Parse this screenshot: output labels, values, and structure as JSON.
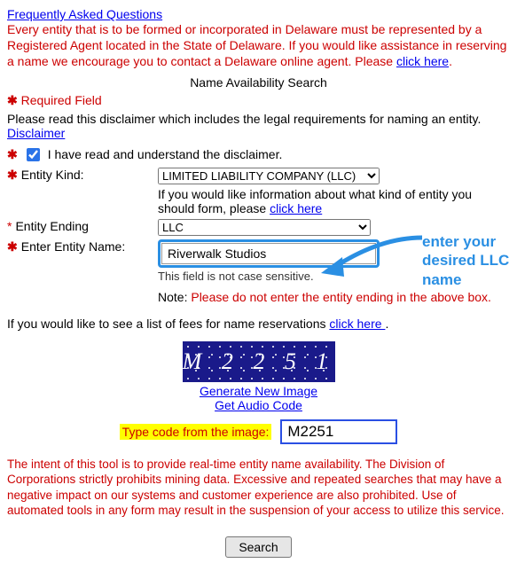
{
  "faq_link": "Frequently Asked Questions",
  "intro_text": "Every entity that is to be formed or incorporated in Delaware must be represented by a Registered Agent located in the State of Delaware. If you would like assistance in reserving a name we encourage you to contact a Delaware online agent. Please ",
  "click_here": "click here",
  "page_title": "Name Availability Search",
  "required_field_label": "Required Field",
  "disclaimer_intro": "Please read this disclaimer which includes the legal requirements for naming an entity.",
  "disclaimer_link": "Disclaimer",
  "consent_label": "I have read and understand the disclaimer.",
  "entity_kind_label": "Entity Kind:",
  "entity_kind_value": "LIMITED LIABILITY COMPANY (LLC)",
  "entity_kind_help": "If you would like information about what kind of entity you should form, please ",
  "entity_ending_label": "Entity Ending",
  "entity_ending_value": "LLC",
  "entity_name_label": "Enter Entity Name:",
  "entity_name_value": "Riverwalk Studios",
  "case_note": "This field is not case sensitive.",
  "no_ending_note_prefix": "Note: ",
  "no_ending_note": "Please do not enter the entity ending in the above box.",
  "fees_text": "If you would like to see a list of fees for name reservations ",
  "fees_link": "click here ",
  "captcha_text": "M 2 2 5 1",
  "gen_new_image": "Generate New Image",
  "get_audio": "Get Audio Code",
  "type_code_label": "Type code from the image:",
  "code_value": "M2251",
  "policy_text": "The intent of this tool is to provide real-time entity name availability. The Division of Corporations strictly prohibits mining data. Excessive and repeated searches that may have a negative impact on our systems and customer experience are also prohibited. Use of automated tools in any form may result in the suspension of your access to utilize this service.",
  "search_label": "Search",
  "annotation": {
    "line1": "enter your",
    "line2": "desired LLC",
    "line3": "name"
  }
}
